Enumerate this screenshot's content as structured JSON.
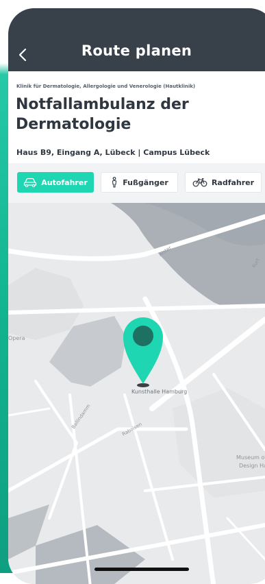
{
  "header": {
    "title": "Route planen"
  },
  "place": {
    "clinic": "Klinik für Dermatologie, Allergologie und Venerologie (Hautklinik)",
    "name": "Notfallambulanz der Dermatologie",
    "address": "Haus B9, Eingang A, Lübeck | Campus Lübeck"
  },
  "modes": [
    {
      "label": "Autofahrer",
      "icon": "car-icon",
      "active": true
    },
    {
      "label": "Fußgänger",
      "icon": "pedestrian-icon",
      "active": false
    },
    {
      "label": "Radfahrer",
      "icon": "bicycle-icon",
      "active": false
    }
  ],
  "map": {
    "labels": {
      "alster": "Alster",
      "opera": "Opera",
      "kunsthalle": "Kunsthalle Hamburg",
      "ballindamm": "Ballindamm",
      "raboisen": "Raboisen",
      "museum_line1": "Museum of A",
      "museum_line2": "Design Ham",
      "kurt": "Kurt"
    }
  },
  "colors": {
    "header_bg": "#384049",
    "accent": "#1fd6b2",
    "pin": "#1fd6b2",
    "pin_dot": "#1e7062",
    "text_dark": "#2f3740"
  }
}
